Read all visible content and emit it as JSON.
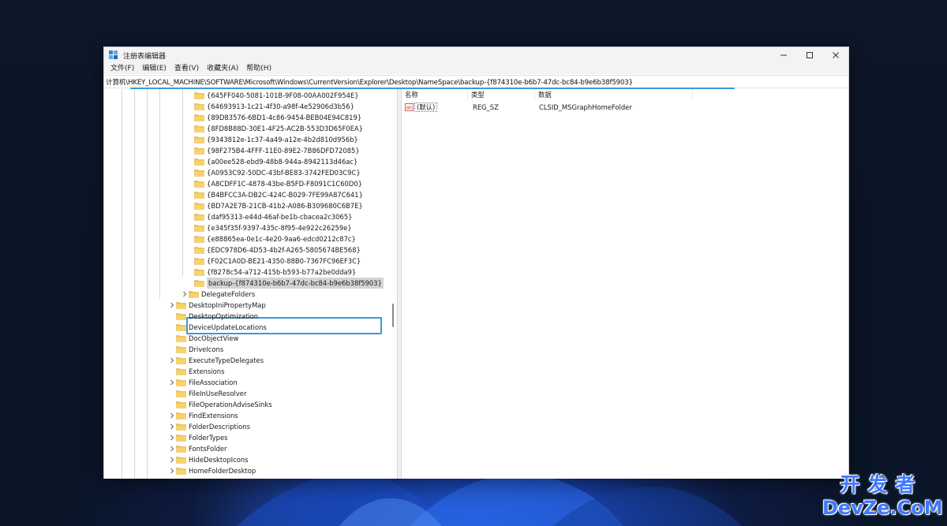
{
  "window": {
    "title": "注册表编辑器",
    "controls": {
      "minimize": "minimize",
      "maximize": "maximize",
      "close": "close"
    }
  },
  "menu": [
    "文件(F)",
    "编辑(E)",
    "查看(V)",
    "收藏夹(A)",
    "帮助(H)"
  ],
  "address": {
    "path": "计算机\\HKEY_LOCAL_MACHINE\\SOFTWARE\\Microsoft\\Windows\\CurrentVersion\\Explorer\\Desktop\\NameSpace\\backup-{f874310e-b6b7-47dc-bc84-b9e6b38f5903}"
  },
  "tree": {
    "namespace_children": [
      "{645FF040-5081-101B-9F08-00AA002F954E}",
      "{64693913-1c21-4f30-a98f-4e52906d3b56}",
      "{89D83576-6BD1-4c86-9454-BEB04E94C819}",
      "{8FD8B88D-30E1-4F25-AC2B-553D3D65F0EA}",
      "{9343812e-1c37-4a49-a12e-4b2d810d956b}",
      "{98F275B4-4FFF-11E0-89E2-7B86DFD72085}",
      "{a00ee528-ebd9-48b8-944a-8942113d46ac}",
      "{A0953C92-50DC-43bf-BE83-3742FED03C9C}",
      "{A8CDFF1C-4878-43be-B5FD-F8091C1C60D0}",
      "{B4BFCC3A-DB2C-424C-B029-7FE99A87C641}",
      "{BD7A2E7B-21CB-41b2-A086-B309680C6B7E}",
      "{daf95313-e44d-46af-be1b-cbacea2c3065}",
      "{e345f35f-9397-435c-8f95-4e922c26259e}",
      "{e88865ea-0e1c-4e20-9aa6-edcd0212c87c}",
      "{EDC978D6-4D53-4b2f-A265-5805674BE568}",
      "{F02C1A0D-BE21-4350-88B0-7367FC96EF3C}",
      "{f8278c54-a712-415b-b593-b77a2be0dda9}"
    ],
    "selected_key": "backup-{f874310e-b6b7-47dc-bc84-b9e6b38f5903}",
    "sibling_after_namespace": "DelegateFolders",
    "explorer_children": [
      {
        "name": "DesktopIniPropertyMap",
        "expandable": true
      },
      {
        "name": "DesktopOptimization",
        "expandable": false
      },
      {
        "name": "DeviceUpdateLocations",
        "expandable": false
      },
      {
        "name": "DocObjectView",
        "expandable": false
      },
      {
        "name": "DriveIcons",
        "expandable": false
      },
      {
        "name": "ExecuteTypeDelegates",
        "expandable": true
      },
      {
        "name": "Extensions",
        "expandable": false
      },
      {
        "name": "FileAssociation",
        "expandable": true
      },
      {
        "name": "FileInUseResolver",
        "expandable": false
      },
      {
        "name": "FileOperationAdviseSinks",
        "expandable": false
      },
      {
        "name": "FindExtensions",
        "expandable": true
      },
      {
        "name": "FolderDescriptions",
        "expandable": true
      },
      {
        "name": "FolderTypes",
        "expandable": true
      },
      {
        "name": "FontsFolder",
        "expandable": true
      },
      {
        "name": "HideDesktopIcons",
        "expandable": true
      },
      {
        "name": "HomeFolderDesktop",
        "expandable": true
      }
    ]
  },
  "values": {
    "headers": {
      "name": "名称",
      "type": "类型",
      "data": "数据"
    },
    "rows": [
      {
        "name": "(默认)",
        "type": "REG_SZ",
        "data": "CLSID_MSGraphHomeFolder",
        "icon": "string-value-icon"
      }
    ]
  },
  "watermark": {
    "cn": "开发者",
    "en": "DevZe.CoM"
  },
  "colors": {
    "highlight": "#3b9ad8",
    "folder": "#f2c24f",
    "watermark": "#3d78ff"
  }
}
